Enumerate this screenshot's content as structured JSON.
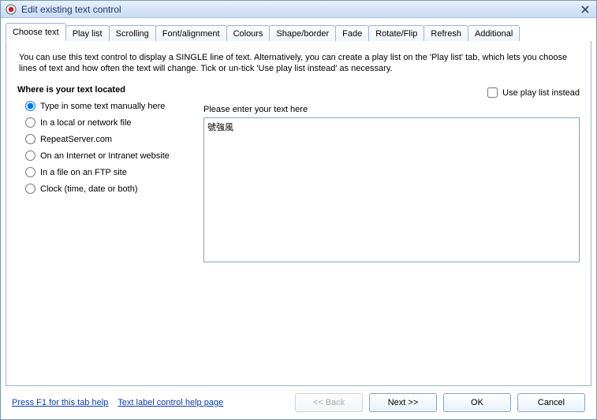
{
  "window": {
    "title": "Edit existing text control"
  },
  "tabs": [
    {
      "label": "Choose text",
      "selected": true
    },
    {
      "label": "Play list"
    },
    {
      "label": "Scrolling"
    },
    {
      "label": "Font/alignment"
    },
    {
      "label": "Colours"
    },
    {
      "label": "Shape/border"
    },
    {
      "label": "Fade"
    },
    {
      "label": "Rotate/Flip"
    },
    {
      "label": "Refresh"
    },
    {
      "label": "Additional"
    }
  ],
  "intro": "You can use this text control to display a SINGLE line of text.  Alternatively, you can create a play list on the 'Play list' tab, which lets you choose lines of text and how often the text will change.  Tick or un-tick 'Use play list instead' as necessary.",
  "left": {
    "heading": "Where is your text located",
    "options": [
      "Type in some text manually here",
      "In a local or network file",
      "RepeatServer.com",
      "On an Internet or Intranet website",
      "In a file on an FTP site",
      "Clock (time, date or both)"
    ],
    "selected_index": 0
  },
  "right": {
    "use_playlist_label": "Use play list instead",
    "use_playlist_checked": false,
    "field_label": "Please enter your text here",
    "text_value": "號強風"
  },
  "footer": {
    "help_link_1": "Press F1 for this tab help",
    "help_link_2": "Text label control help page",
    "back": "<< Back",
    "next": "Next >>",
    "ok": "OK",
    "cancel": "Cancel"
  }
}
